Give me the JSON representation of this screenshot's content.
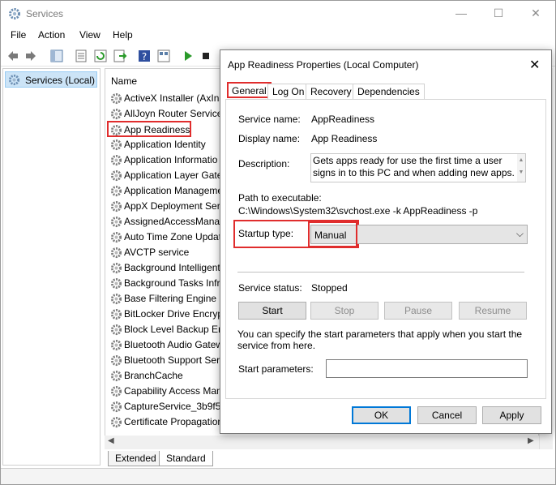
{
  "window": {
    "title": "Services",
    "minimize": "—",
    "maximize": "☐",
    "close": "✕"
  },
  "menu": [
    "File",
    "Action",
    "View",
    "Help"
  ],
  "tree": {
    "root_label": "Services (Local)"
  },
  "list": {
    "column_name": "Name",
    "rows": [
      "ActiveX Installer (AxInst",
      "AllJoyn Router Service",
      "App Readiness",
      "Application Identity",
      "Application Informatio",
      "Application Layer Gate",
      "Application Manageme",
      "AppX Deployment Serv",
      "AssignedAccessManag",
      "Auto Time Zone Updat",
      "AVCTP service",
      "Background Intelligent",
      "Background Tasks Infra",
      "Base Filtering Engine",
      "BitLocker Drive Encrypt",
      "Block Level Backup Eng",
      "Bluetooth Audio Gatew",
      "Bluetooth Support Serv",
      "BranchCache",
      "Capability Access Mana",
      "CaptureService_3b9f5",
      "Certificate Propagation"
    ],
    "selected_index": 2
  },
  "bottom_tabs": [
    "Extended",
    "Standard"
  ],
  "dialog": {
    "title": "App Readiness Properties (Local Computer)",
    "close": "✕",
    "tabs": [
      "General",
      "Log On",
      "Recovery",
      "Dependencies"
    ],
    "active_tab": "General",
    "service_name_label": "Service name:",
    "service_name": "AppReadiness",
    "display_name_label": "Display name:",
    "display_name": "App Readiness",
    "description_label": "Description:",
    "description": "Gets apps ready for use the first time a user signs in to this PC and when adding new apps.",
    "path_label": "Path to executable:",
    "path": "C:\\Windows\\System32\\svchost.exe -k AppReadiness -p",
    "startup_type_label": "Startup type:",
    "startup_type": "Manual",
    "status_label": "Service status:",
    "status": "Stopped",
    "buttons": {
      "start": "Start",
      "stop": "Stop",
      "pause": "Pause",
      "resume": "Resume"
    },
    "hint": "You can specify the start parameters that apply when you start the service from here.",
    "params_label": "Start parameters:",
    "params_value": "",
    "ok": "OK",
    "cancel": "Cancel",
    "apply": "Apply"
  },
  "colors": {
    "highlight": "#e02d2d",
    "selection": "#cce4f7",
    "focus": "#0078d7"
  }
}
